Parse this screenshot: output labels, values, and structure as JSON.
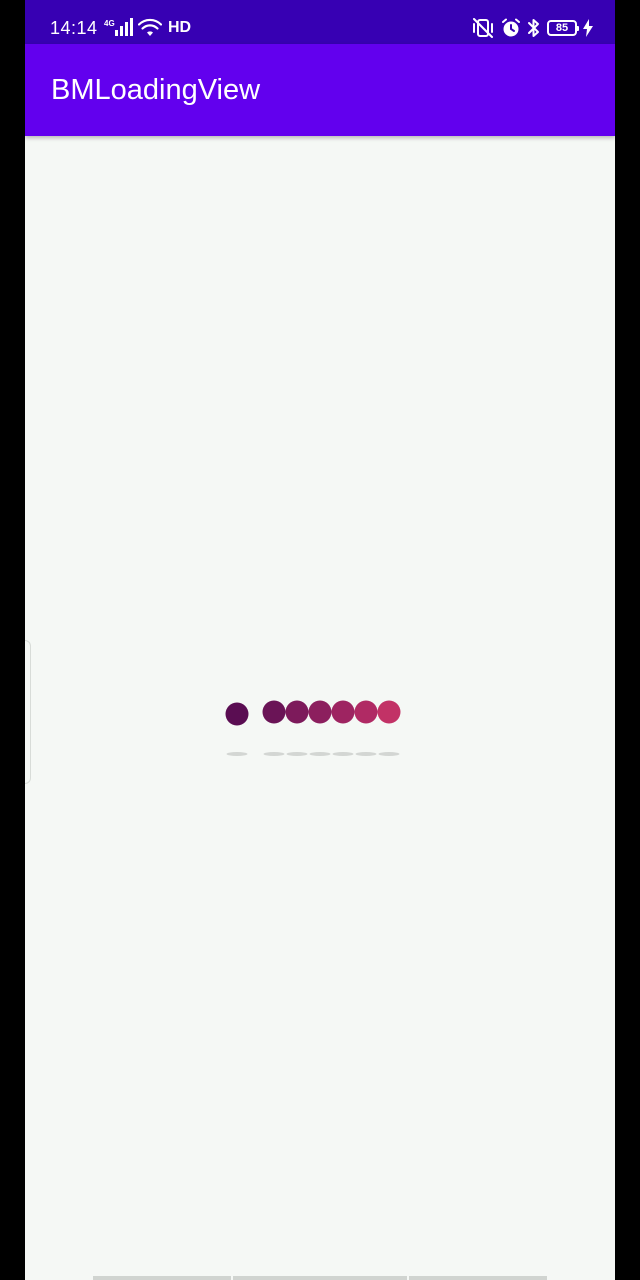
{
  "status_bar": {
    "time": "14:14",
    "network_label": "4G",
    "hd_label": "HD",
    "battery_level": "85",
    "icons": [
      "signal-icon",
      "wifi-icon",
      "vibrate-off-icon",
      "alarm-icon",
      "bluetooth-icon",
      "battery-icon",
      "charging-icon"
    ],
    "background": "#3700b3"
  },
  "app_bar": {
    "title": "BMLoadingView",
    "background": "#6200ee",
    "text_color": "#ffffff"
  },
  "content": {
    "background": "#f5f8f5"
  },
  "loading_view": {
    "dot_colors": [
      "#5a0d52",
      "#6a1456",
      "#7d1a5b",
      "#8c1f5e",
      "#9e2461",
      "#b02a64",
      "#c23266"
    ],
    "shadow_color": "#d3d6d3"
  }
}
